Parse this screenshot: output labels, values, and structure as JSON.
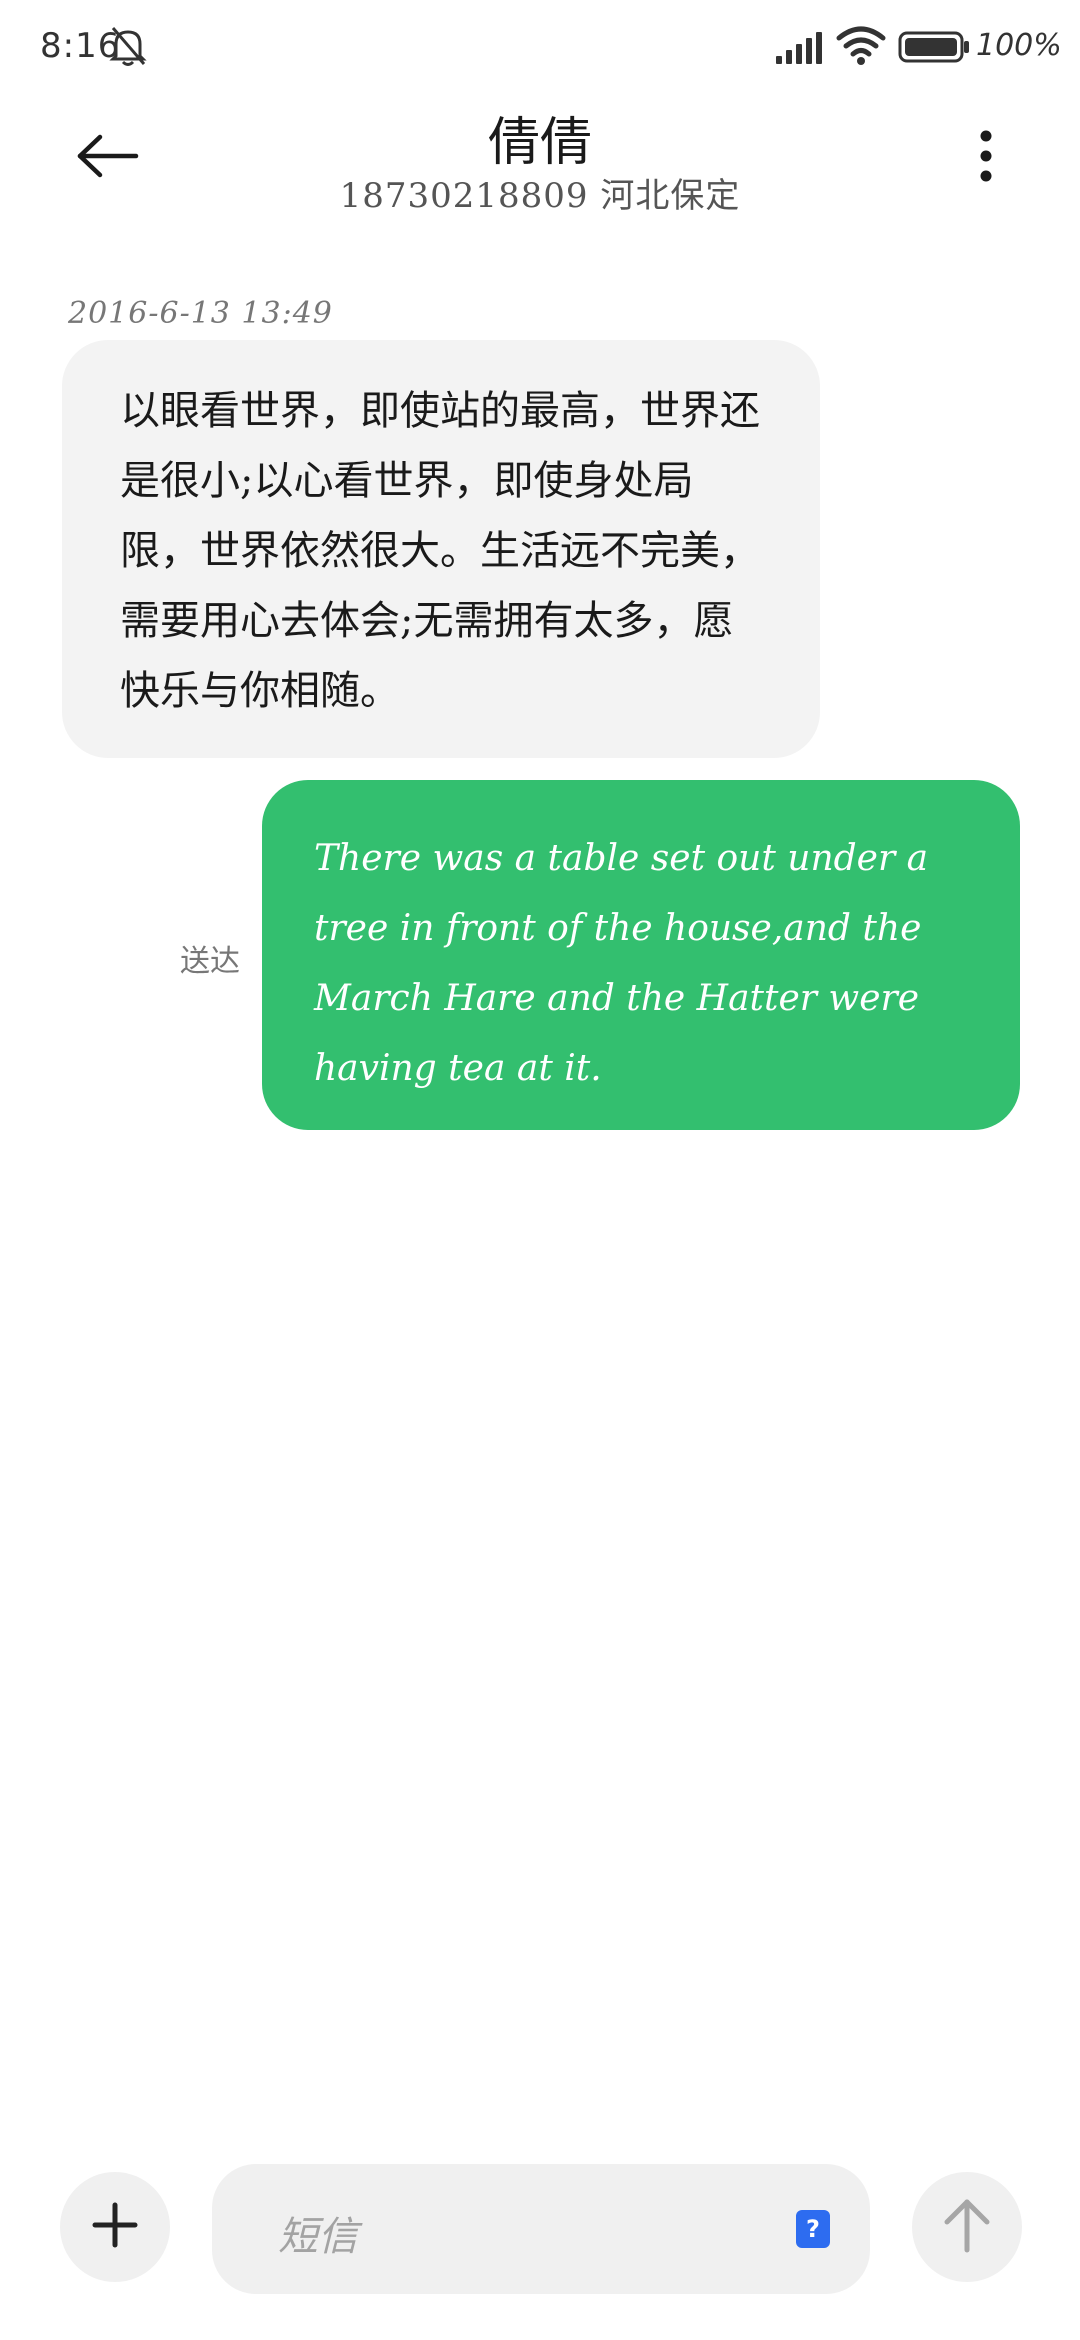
{
  "status_bar": {
    "time": "8:16",
    "battery_text": "100%",
    "icons": [
      "bell-off-icon",
      "signal-icon",
      "wifi-icon",
      "battery-icon"
    ]
  },
  "header": {
    "contact_name": "倩倩",
    "contact_sub": "18730218809 河北保定",
    "back_icon": "arrow-left-icon",
    "more_icon": "more-vertical-icon"
  },
  "conversation": {
    "timestamp": "2016-6-13 13:49",
    "incoming_message": "以眼看世界，即使站的最高，世界还是很小;以心看世界，即使身处局限，世界依然很大。生活远不完美，需要用心去体会;无需拥有太多，愿快乐与你相随。",
    "outgoing_message": "There was a table set out under a tree in front of the house,and the March Hare and the Hatter were having tea at it.",
    "delivery_status": "送达"
  },
  "composer": {
    "placeholder": "短信",
    "attach_icon": "plus-icon",
    "help_badge": "?",
    "send_icon": "arrow-up-icon"
  },
  "colors": {
    "outgoing_bubble": "#33bf6f",
    "incoming_bubble": "#f3f3f3",
    "composer_background": "#f0f0f0",
    "help_badge": "#2d6cf0"
  }
}
